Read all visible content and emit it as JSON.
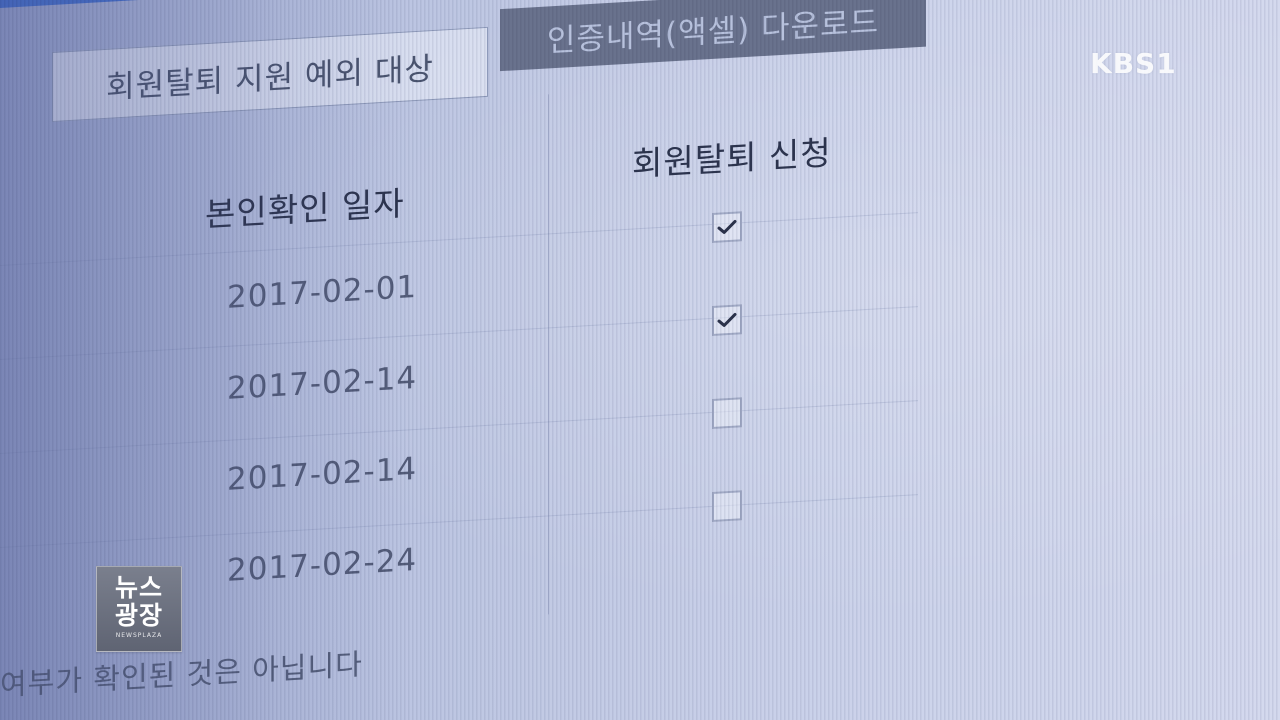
{
  "tabs": {
    "active_label": "회원탈퇴 지원 예외 대상",
    "download_label": "인증내역(액셀) 다운로드"
  },
  "table": {
    "headers": {
      "date": "본인확인 일자",
      "withdraw": "회원탈퇴 신청"
    },
    "rows": [
      {
        "date": "2017-02-01",
        "checked": true
      },
      {
        "date": "2017-02-14",
        "checked": true
      },
      {
        "date": "2017-02-14",
        "checked": false
      },
      {
        "date": "2017-02-24",
        "checked": false
      }
    ]
  },
  "footer_text": "여부가 확인된 것은 아닙니다",
  "broadcast": {
    "channel_logo": "KBS1",
    "program_logo_line1": "뉴스",
    "program_logo_line2": "광장",
    "program_logo_sub": "NEWSPLAZA"
  },
  "colors": {
    "screen_bg": "#c3cbe5",
    "button_bg": "#69728d",
    "text_dark": "#2d354f",
    "text_mid": "#545d7a",
    "accent_blue": "#3b67c7"
  },
  "icons": {
    "checkbox_checked": "check-mark-icon",
    "checkbox_unchecked": "empty-checkbox"
  }
}
